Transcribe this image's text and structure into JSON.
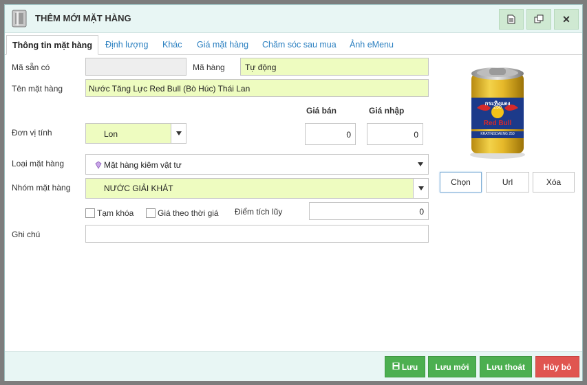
{
  "window": {
    "title": "THÊM MỚI MẶT HÀNG"
  },
  "title_buttons": {
    "doc_icon": "document-icon",
    "copy_icon": "copy-icon",
    "close_icon": "close-icon",
    "close_glyph": "✕"
  },
  "tabs": [
    {
      "label": "Thông tin mặt hàng",
      "active": true
    },
    {
      "label": "Định lượng"
    },
    {
      "label": "Khác"
    },
    {
      "label": "Giá mặt hàng"
    },
    {
      "label": "Chăm sóc sau mua"
    },
    {
      "label": "Ảnh eMenu"
    }
  ],
  "form": {
    "ma_san_co_label": "Mã sẵn có",
    "ma_san_co_value": "",
    "ma_hang_label": "Mã hàng",
    "ma_hang_value": "Tự động",
    "ten_label": "Tên mặt hàng",
    "ten_value": "Nước Tăng Lực Red Bull (Bò Húc) Thái Lan",
    "gia_ban_label": "Giá bán",
    "gia_nhap_label": "Giá nhập",
    "don_vi_label": "Đơn vị tính",
    "don_vi_value": "Lon",
    "gia_ban_value": "0",
    "gia_nhap_value": "0",
    "loai_label": "Loại mặt hàng",
    "loai_value": "Mặt hàng kiêm vật tư",
    "nhom_label": "Nhóm mặt hàng",
    "nhom_value": "NƯỚC GIẢI KHÁT",
    "tam_khoa_label": "Tạm khóa",
    "gia_thoi_gia_label": "Giá theo thời giá",
    "diem_label": "Điểm tích lũy",
    "diem_value": "0",
    "ghi_chu_label": "Ghi chú",
    "ghi_chu_value": ""
  },
  "image": {
    "can_brand": "Red Bull",
    "can_thai_text": "กระทิงแดง",
    "can_250": "250",
    "can_bottom": "KRATINGDAENG 250",
    "btn_chon": "Chọn",
    "btn_url": "Url",
    "btn_xoa": "Xóa"
  },
  "footer": {
    "luu": "Lưu",
    "luu_moi": "Lưu mới",
    "luu_thoat": "Lưu thoát",
    "huy_bo": "Hủy bỏ"
  },
  "colors": {
    "header_bg": "#e8f6f4",
    "input_highlight": "#eefcc0",
    "green_button": "#4caf50",
    "red_button": "#e05550",
    "tab_link": "#2a7fc0"
  }
}
